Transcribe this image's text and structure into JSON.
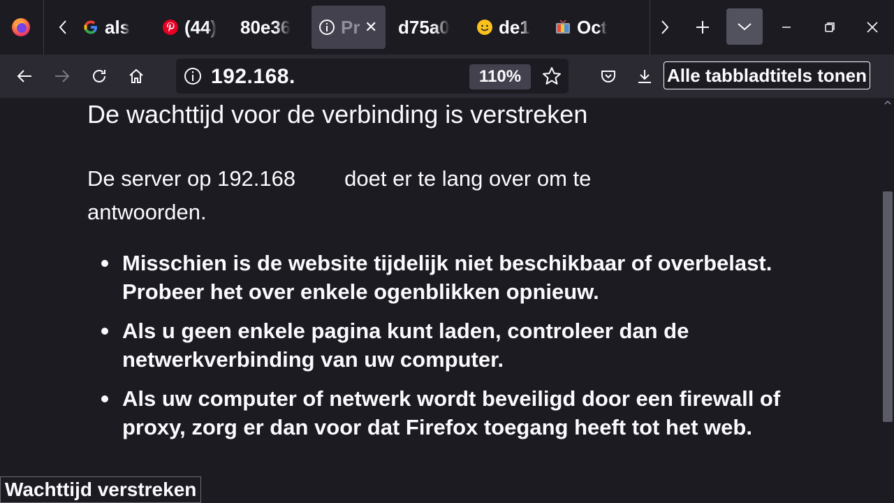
{
  "colors": {
    "tabbar_bg": "#1c1b22",
    "navbar_bg": "#2b2a33",
    "active_tab_bg": "#42414d",
    "text": "#fbfbfe"
  },
  "tabs": [
    {
      "title": "als",
      "icon": "google-icon"
    },
    {
      "title": "(44)",
      "icon": "pinterest-icon"
    },
    {
      "title": "80e36",
      "icon": ""
    },
    {
      "title": "Pr",
      "icon": "info-icon",
      "active": true
    },
    {
      "title": "d75a0",
      "icon": ""
    },
    {
      "title": "de1",
      "icon": "smiley-icon"
    },
    {
      "title": "Oct",
      "icon": "tv-icon"
    }
  ],
  "url_bar": {
    "url": "192.168.",
    "zoom": "110%"
  },
  "tooltip": "Alle tabbladtitels tonen",
  "page": {
    "title": "De wachttijd voor de verbinding is verstreken",
    "desc_part1": "De server op 192.168",
    "desc_part2": "doet er te lang over om te antwoorden.",
    "tips": [
      "Misschien is de website tijdelijk niet beschikbaar of overbelast. Probeer het over enkele ogenblikken opnieuw.",
      "Als u geen enkele pagina kunt laden, controleer dan de netwerkverbinding van uw computer.",
      "Als uw computer of netwerk wordt beveiligd door een firewall of proxy, zorg er dan voor dat Firefox toegang heeft tot het web."
    ]
  },
  "status": "Wachttijd verstreken"
}
